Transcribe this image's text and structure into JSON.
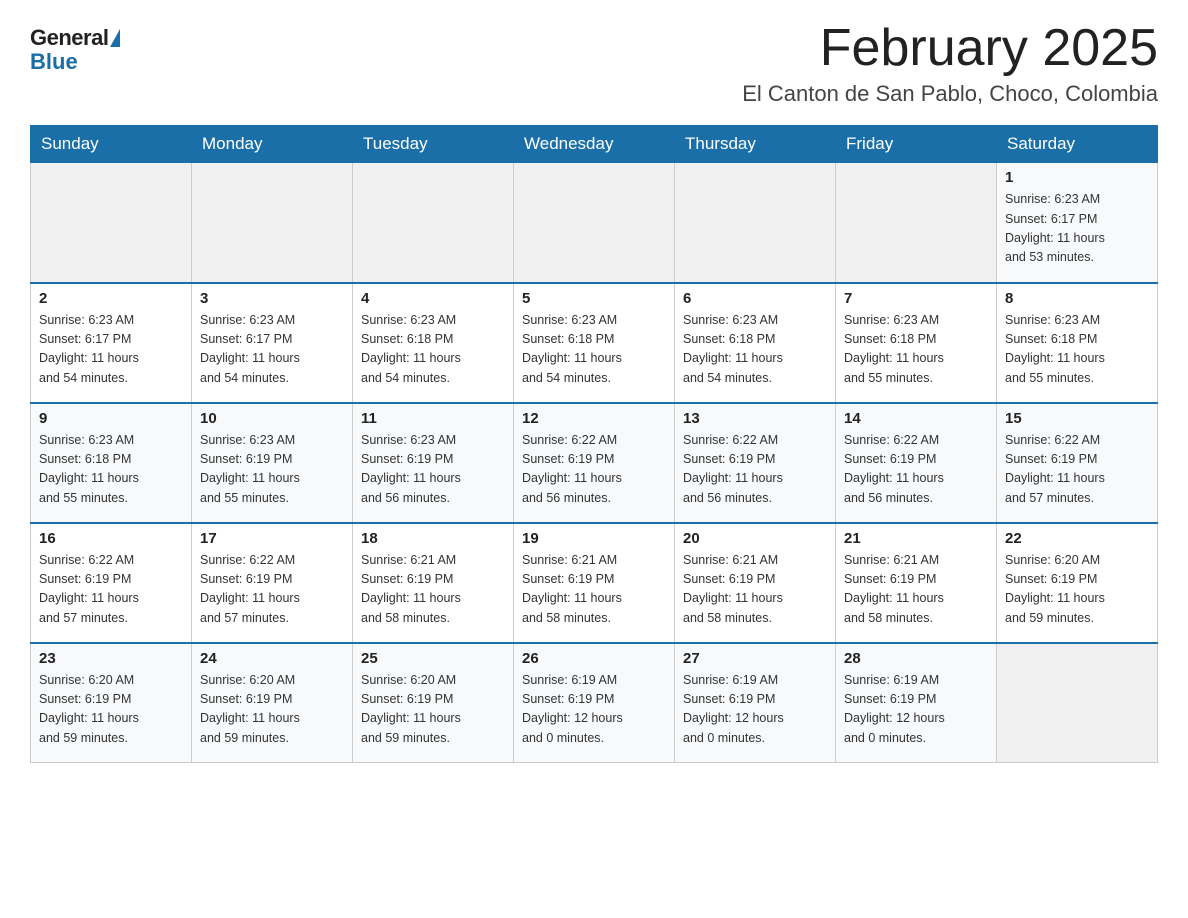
{
  "logo": {
    "general": "General",
    "blue": "Blue"
  },
  "header": {
    "month_year": "February 2025",
    "location": "El Canton de San Pablo, Choco, Colombia"
  },
  "weekdays": [
    "Sunday",
    "Monday",
    "Tuesday",
    "Wednesday",
    "Thursday",
    "Friday",
    "Saturday"
  ],
  "weeks": [
    [
      {
        "day": "",
        "info": ""
      },
      {
        "day": "",
        "info": ""
      },
      {
        "day": "",
        "info": ""
      },
      {
        "day": "",
        "info": ""
      },
      {
        "day": "",
        "info": ""
      },
      {
        "day": "",
        "info": ""
      },
      {
        "day": "1",
        "info": "Sunrise: 6:23 AM\nSunset: 6:17 PM\nDaylight: 11 hours\nand 53 minutes."
      }
    ],
    [
      {
        "day": "2",
        "info": "Sunrise: 6:23 AM\nSunset: 6:17 PM\nDaylight: 11 hours\nand 54 minutes."
      },
      {
        "day": "3",
        "info": "Sunrise: 6:23 AM\nSunset: 6:17 PM\nDaylight: 11 hours\nand 54 minutes."
      },
      {
        "day": "4",
        "info": "Sunrise: 6:23 AM\nSunset: 6:18 PM\nDaylight: 11 hours\nand 54 minutes."
      },
      {
        "day": "5",
        "info": "Sunrise: 6:23 AM\nSunset: 6:18 PM\nDaylight: 11 hours\nand 54 minutes."
      },
      {
        "day": "6",
        "info": "Sunrise: 6:23 AM\nSunset: 6:18 PM\nDaylight: 11 hours\nand 54 minutes."
      },
      {
        "day": "7",
        "info": "Sunrise: 6:23 AM\nSunset: 6:18 PM\nDaylight: 11 hours\nand 55 minutes."
      },
      {
        "day": "8",
        "info": "Sunrise: 6:23 AM\nSunset: 6:18 PM\nDaylight: 11 hours\nand 55 minutes."
      }
    ],
    [
      {
        "day": "9",
        "info": "Sunrise: 6:23 AM\nSunset: 6:18 PM\nDaylight: 11 hours\nand 55 minutes."
      },
      {
        "day": "10",
        "info": "Sunrise: 6:23 AM\nSunset: 6:19 PM\nDaylight: 11 hours\nand 55 minutes."
      },
      {
        "day": "11",
        "info": "Sunrise: 6:23 AM\nSunset: 6:19 PM\nDaylight: 11 hours\nand 56 minutes."
      },
      {
        "day": "12",
        "info": "Sunrise: 6:22 AM\nSunset: 6:19 PM\nDaylight: 11 hours\nand 56 minutes."
      },
      {
        "day": "13",
        "info": "Sunrise: 6:22 AM\nSunset: 6:19 PM\nDaylight: 11 hours\nand 56 minutes."
      },
      {
        "day": "14",
        "info": "Sunrise: 6:22 AM\nSunset: 6:19 PM\nDaylight: 11 hours\nand 56 minutes."
      },
      {
        "day": "15",
        "info": "Sunrise: 6:22 AM\nSunset: 6:19 PM\nDaylight: 11 hours\nand 57 minutes."
      }
    ],
    [
      {
        "day": "16",
        "info": "Sunrise: 6:22 AM\nSunset: 6:19 PM\nDaylight: 11 hours\nand 57 minutes."
      },
      {
        "day": "17",
        "info": "Sunrise: 6:22 AM\nSunset: 6:19 PM\nDaylight: 11 hours\nand 57 minutes."
      },
      {
        "day": "18",
        "info": "Sunrise: 6:21 AM\nSunset: 6:19 PM\nDaylight: 11 hours\nand 58 minutes."
      },
      {
        "day": "19",
        "info": "Sunrise: 6:21 AM\nSunset: 6:19 PM\nDaylight: 11 hours\nand 58 minutes."
      },
      {
        "day": "20",
        "info": "Sunrise: 6:21 AM\nSunset: 6:19 PM\nDaylight: 11 hours\nand 58 minutes."
      },
      {
        "day": "21",
        "info": "Sunrise: 6:21 AM\nSunset: 6:19 PM\nDaylight: 11 hours\nand 58 minutes."
      },
      {
        "day": "22",
        "info": "Sunrise: 6:20 AM\nSunset: 6:19 PM\nDaylight: 11 hours\nand 59 minutes."
      }
    ],
    [
      {
        "day": "23",
        "info": "Sunrise: 6:20 AM\nSunset: 6:19 PM\nDaylight: 11 hours\nand 59 minutes."
      },
      {
        "day": "24",
        "info": "Sunrise: 6:20 AM\nSunset: 6:19 PM\nDaylight: 11 hours\nand 59 minutes."
      },
      {
        "day": "25",
        "info": "Sunrise: 6:20 AM\nSunset: 6:19 PM\nDaylight: 11 hours\nand 59 minutes."
      },
      {
        "day": "26",
        "info": "Sunrise: 6:19 AM\nSunset: 6:19 PM\nDaylight: 12 hours\nand 0 minutes."
      },
      {
        "day": "27",
        "info": "Sunrise: 6:19 AM\nSunset: 6:19 PM\nDaylight: 12 hours\nand 0 minutes."
      },
      {
        "day": "28",
        "info": "Sunrise: 6:19 AM\nSunset: 6:19 PM\nDaylight: 12 hours\nand 0 minutes."
      },
      {
        "day": "",
        "info": ""
      }
    ]
  ],
  "colors": {
    "header_bg": "#1a6fa8",
    "header_text": "#ffffff",
    "accent": "#1a6fa8"
  }
}
